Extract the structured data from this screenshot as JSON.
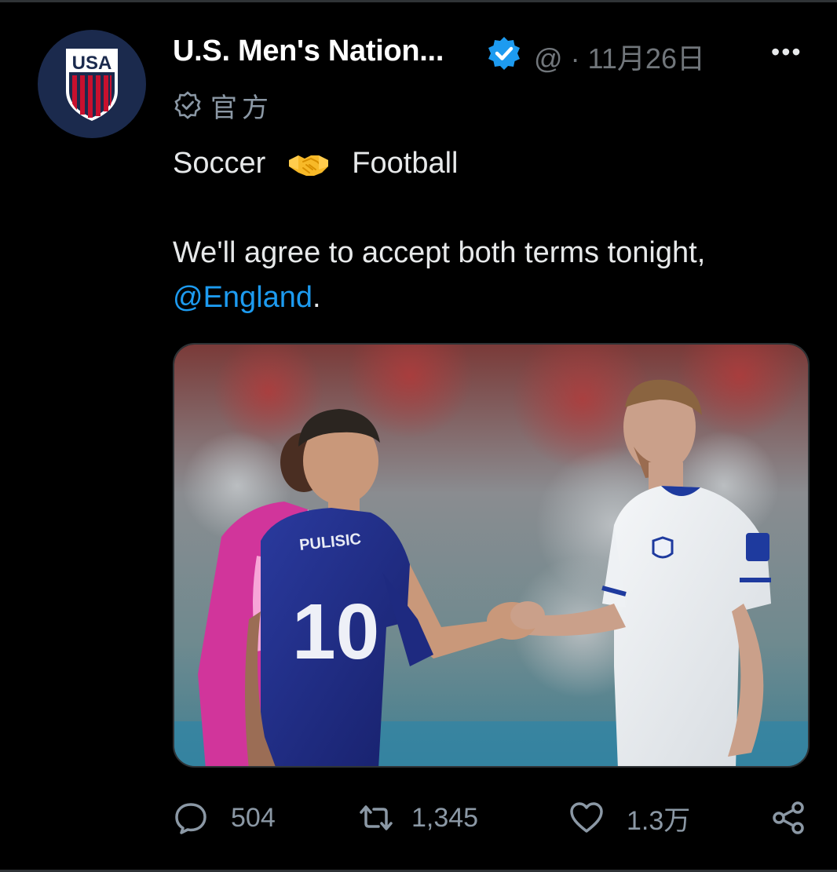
{
  "tweet": {
    "author": {
      "display_name": "U.S. Men's Nation...",
      "separator": "@",
      "date": "· 11月26日",
      "official_label": "官方",
      "avatar_logo_text": "USA"
    },
    "more_label": "•••",
    "text": {
      "line1_left": "Soccer",
      "line1_emoji": "handshake-emoji",
      "line1_right": "Football",
      "line2": "We'll agree to accept both terms tonight,",
      "mention": "@England",
      "mention_suffix": "."
    },
    "media": {
      "description_player_left_number": "10",
      "description_player_left_name": "PULISIC"
    },
    "actions": {
      "replies": "504",
      "retweets": "1,345",
      "likes": "1.3万"
    }
  },
  "colors": {
    "background": "#000000",
    "text": "#e7e9ea",
    "muted": "#71767b",
    "link": "#1d9bf0",
    "verified": "#1d9bf0"
  }
}
